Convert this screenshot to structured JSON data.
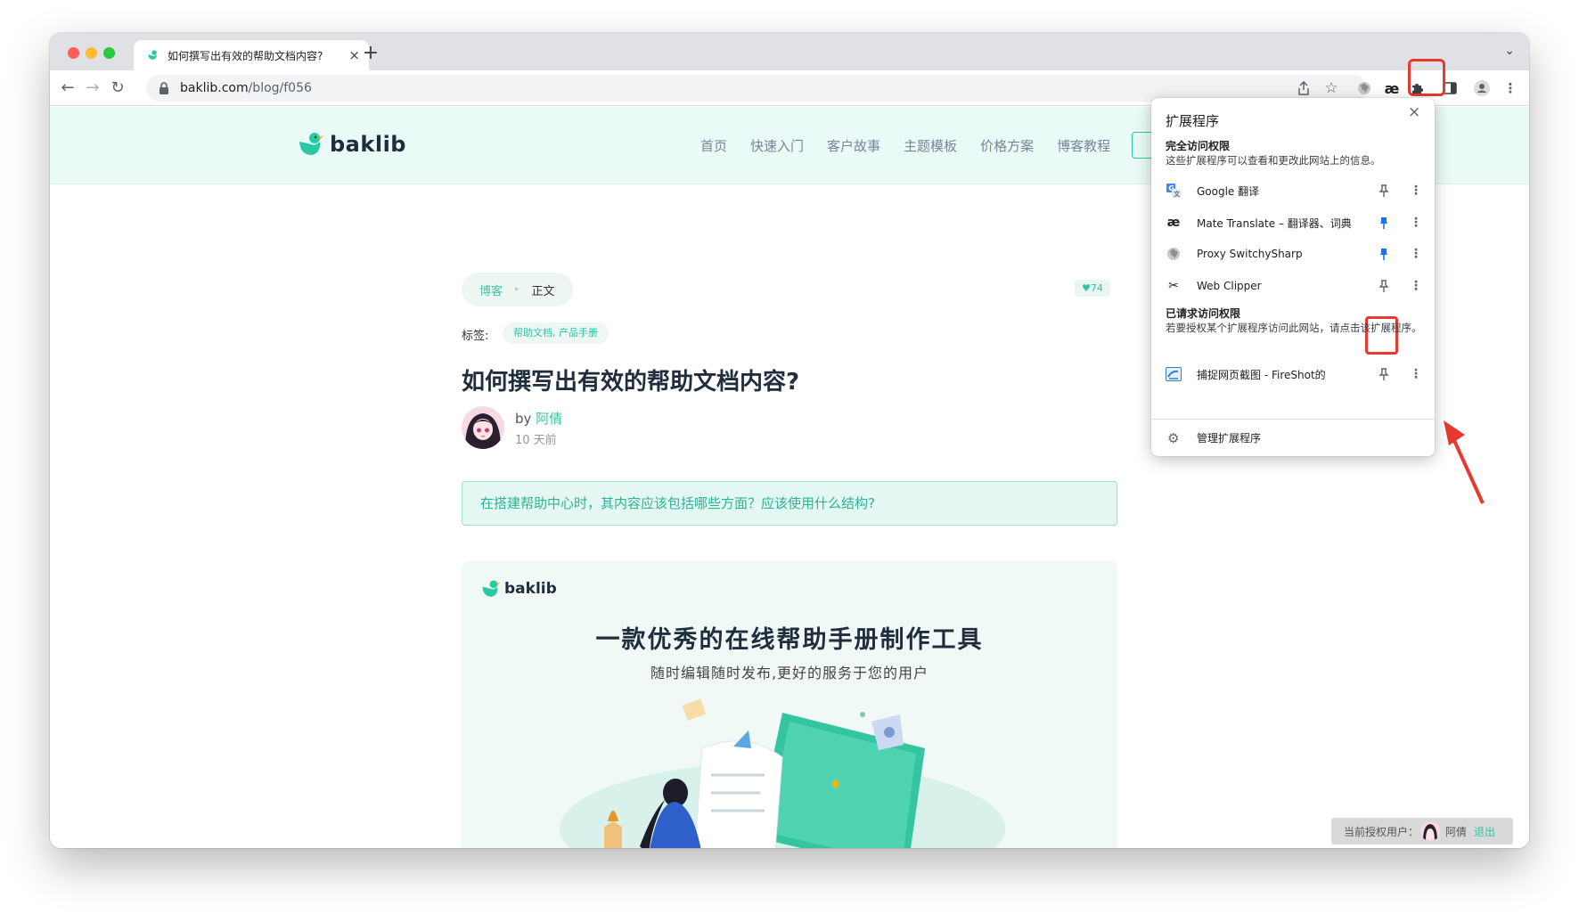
{
  "browser": {
    "tab_title": "如何撰写出有效的帮助文档内容?",
    "tab_close": "×",
    "new_tab": "+",
    "tab_menu": "⌄",
    "url_domain": "baklib.com",
    "url_path": "/blog/f056"
  },
  "site": {
    "logo_text": "baklib",
    "nav": [
      "首页",
      "快速入门",
      "客户故事",
      "主题模板",
      "价格方案",
      "博客教程"
    ]
  },
  "article": {
    "breadcrumb_parent": "博客",
    "breadcrumb_sep": "▸",
    "breadcrumb_current": "正文",
    "likes": "♥74",
    "tags_label": "标签:",
    "tags": "帮助文档, 产品手册",
    "title": "如何撰写出有效的帮助文档内容?",
    "author_prefix": "by",
    "author_name": "阿倩",
    "time_ago": "10 天前",
    "callout": "在搭建帮助中心时，其内容应该包括哪些方面？应该使用什么结构?"
  },
  "banner": {
    "logo_text": "baklib",
    "title": "一款优秀的在线帮助手册制作工具",
    "subtitle": "随时编辑随时发布,更好的服务于您的用户"
  },
  "auth_bar": {
    "label": "当前授权用户：",
    "user": "阿倩",
    "logout": "退出"
  },
  "extensions_popup": {
    "title": "扩展程序",
    "close": "×",
    "full_access_title": "完全访问权限",
    "full_access_desc": "这些扩展程序可以查看和更改此网站上的信息。",
    "full_access": [
      {
        "name": "Google 翻译",
        "icon": "google-translate-icon",
        "pinned": false
      },
      {
        "name": "Mate Translate – 翻译器、词典",
        "icon": "mate-translate-icon",
        "icon_glyph": "æ",
        "pinned": true
      },
      {
        "name": "Proxy SwitchySharp",
        "icon": "globe-icon",
        "pinned": true
      },
      {
        "name": "Web Clipper",
        "icon": "scissors-icon",
        "icon_glyph": "✂",
        "pinned": false
      }
    ],
    "requested_title": "已请求访问权限",
    "requested_desc": "若要授权某个扩展程序访问此网站，请点击该扩展程序。",
    "requested": [
      {
        "name": "捕捉网页截图 - FireShot的",
        "icon": "fireshot-icon",
        "pinned": false
      }
    ],
    "manage": "管理扩展程序",
    "more_glyph": "⋮"
  },
  "colors": {
    "accent": "#2bc8a4",
    "header_bg": "#eafaf6",
    "highlight_red": "#e8392f",
    "pin_blue": "#1a73e8"
  }
}
